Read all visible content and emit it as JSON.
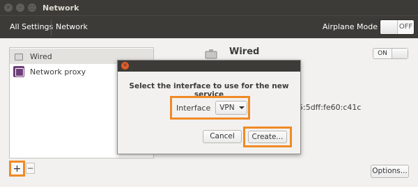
{
  "window": {
    "title": "Network",
    "controls": [
      "close-icon",
      "minimize-icon",
      "maximize-icon"
    ]
  },
  "toolbar": {
    "all_settings_label": "All Settings",
    "breadcrumb": "Network",
    "airplane_mode_label": "Airplane Mode",
    "airplane_mode_state": "OFF"
  },
  "sidebar": {
    "items": [
      {
        "label": "Wired",
        "icon": "wired-network-icon",
        "selected": true
      },
      {
        "label": "Network proxy",
        "icon": "network-proxy-icon",
        "selected": false
      }
    ],
    "add_label": "+",
    "remove_label": "−"
  },
  "details": {
    "title": "Wired",
    "toggle_state": "ON",
    "ipv6_partial": "5:5dff:fe60:c41c",
    "options_label": "Options..."
  },
  "dialog": {
    "prompt": "Select the interface to use for the new service",
    "interface_label": "Interface",
    "interface_value": "VPN",
    "cancel_label": "Cancel",
    "create_label": "Create..."
  },
  "colors": {
    "highlight": "#f08a24",
    "titlebar": "#3c3b37",
    "close_button": "#e05a2a"
  }
}
